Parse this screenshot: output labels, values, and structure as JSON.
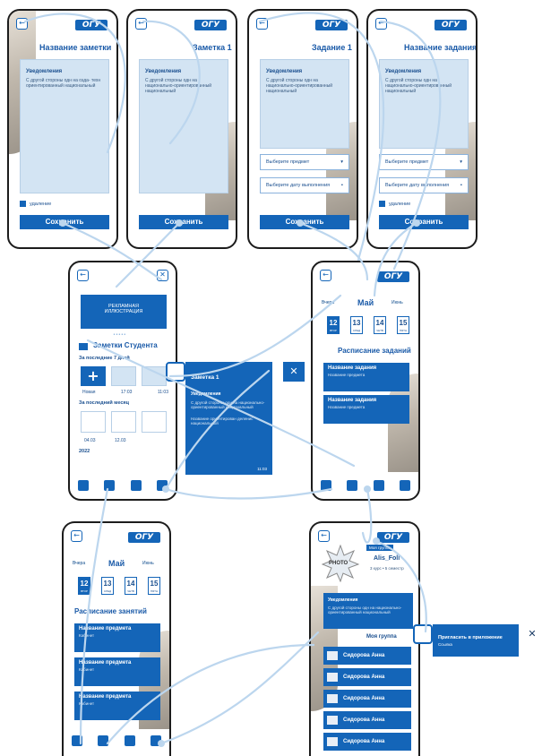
{
  "brand": {
    "logo": "ОГУ",
    "primary_color": "#1465b8",
    "light_color": "#d3e4f3"
  },
  "note_screens": [
    {
      "title": "Название заметки",
      "card_heading": "Уведомления",
      "card_text": "С другой стороны одн на озда- техн ориентированный национальный",
      "checkbox_label": "удаление",
      "save_label": "Сохранить"
    },
    {
      "title": "Заметка 1",
      "card_heading": "Уведомления",
      "card_text": "С другой стороны одн на национально-ориентированный национальный",
      "save_label": "Сохранить"
    }
  ],
  "task_screens": [
    {
      "title": "Задание 1",
      "card_heading": "Уведомления",
      "card_text": "С другой стороны одн на национально-ориентированный национальный",
      "subject_placeholder": "Выберите предмет",
      "date_placeholder": "Выберите дату выполнения",
      "save_label": "Сохранить"
    },
    {
      "title": "Название задания",
      "card_heading": "Уведомления",
      "card_text": "С другой стороны одн на национально-ориентированный национальный",
      "subject_placeholder": "Выберите предмет",
      "date_placeholder": "Выберите дату выполнения",
      "checkbox_label": "удаление",
      "save_label": "Сохранить"
    }
  ],
  "notes_home": {
    "banner": "РЕКЛАМНАЯ ИЛЛЮСТРАЦИЯ",
    "title": "Заметки Студента",
    "section_days": "За последние 7 дней",
    "tile_labels": [
      "Новая",
      "17:03",
      "11:03"
    ],
    "section_month": "За последний месяц",
    "month_dates": [
      "04.03",
      "12.03"
    ],
    "year": "2022"
  },
  "note_popup": {
    "title": "Заметка 1",
    "heading": "Уведомления",
    "text": "С другой стороны одн на национально- ориентированный национальный",
    "text2": "Название ориентирован деленис национальный",
    "time": "11:03",
    "close": "✕"
  },
  "schedule_screen": {
    "prev_label": "Вчера",
    "month": "Май",
    "next_label": "Июнь",
    "days": [
      {
        "num": "12",
        "wd": "ВТОР"
      },
      {
        "num": "13",
        "wd": "СРЕД"
      },
      {
        "num": "14",
        "wd": "ЧЕТВ"
      },
      {
        "num": "15",
        "wd": "ПЯТН"
      }
    ],
    "title": "Расписание заданий",
    "items": [
      {
        "name": "Название задания",
        "sub": "Название предмета"
      },
      {
        "name": "Название задания",
        "sub": "Название предмета"
      }
    ]
  },
  "classes_screen": {
    "prev_label": "Вчера",
    "month": "Май",
    "next_label": "Июнь",
    "days": [
      {
        "num": "12",
        "wd": "ВТОР"
      },
      {
        "num": "13",
        "wd": "СРЕД"
      },
      {
        "num": "14",
        "wd": "ЧЕТВ"
      },
      {
        "num": "15",
        "wd": "ПЯТН"
      }
    ],
    "title": "Расписание занятий",
    "items": [
      {
        "name": "Название предмета",
        "sub": "Кабинет"
      },
      {
        "name": "Название предмета",
        "sub": "Кабинет"
      },
      {
        "name": "Название предмета",
        "sub": "Кабинет"
      }
    ]
  },
  "profile_screen": {
    "photo": "PHOTO",
    "group_tag": "Моя группа",
    "username": "Alis_Foll",
    "meta": "3 курс • 5 семестр",
    "card_heading": "Уведомления",
    "card_text": "С другой стороны одн на национально-ориентированный национальный",
    "group_title": "Моя группа",
    "members": [
      "Сидорова Анна",
      "Сидорова Анна",
      "Сидорова Анна",
      "Сидорова Анна",
      "Сидорова Анна"
    ]
  },
  "invite_popup": {
    "title": "Пригласить в приложение",
    "subtitle": "Ссылка",
    "close": "✕"
  }
}
